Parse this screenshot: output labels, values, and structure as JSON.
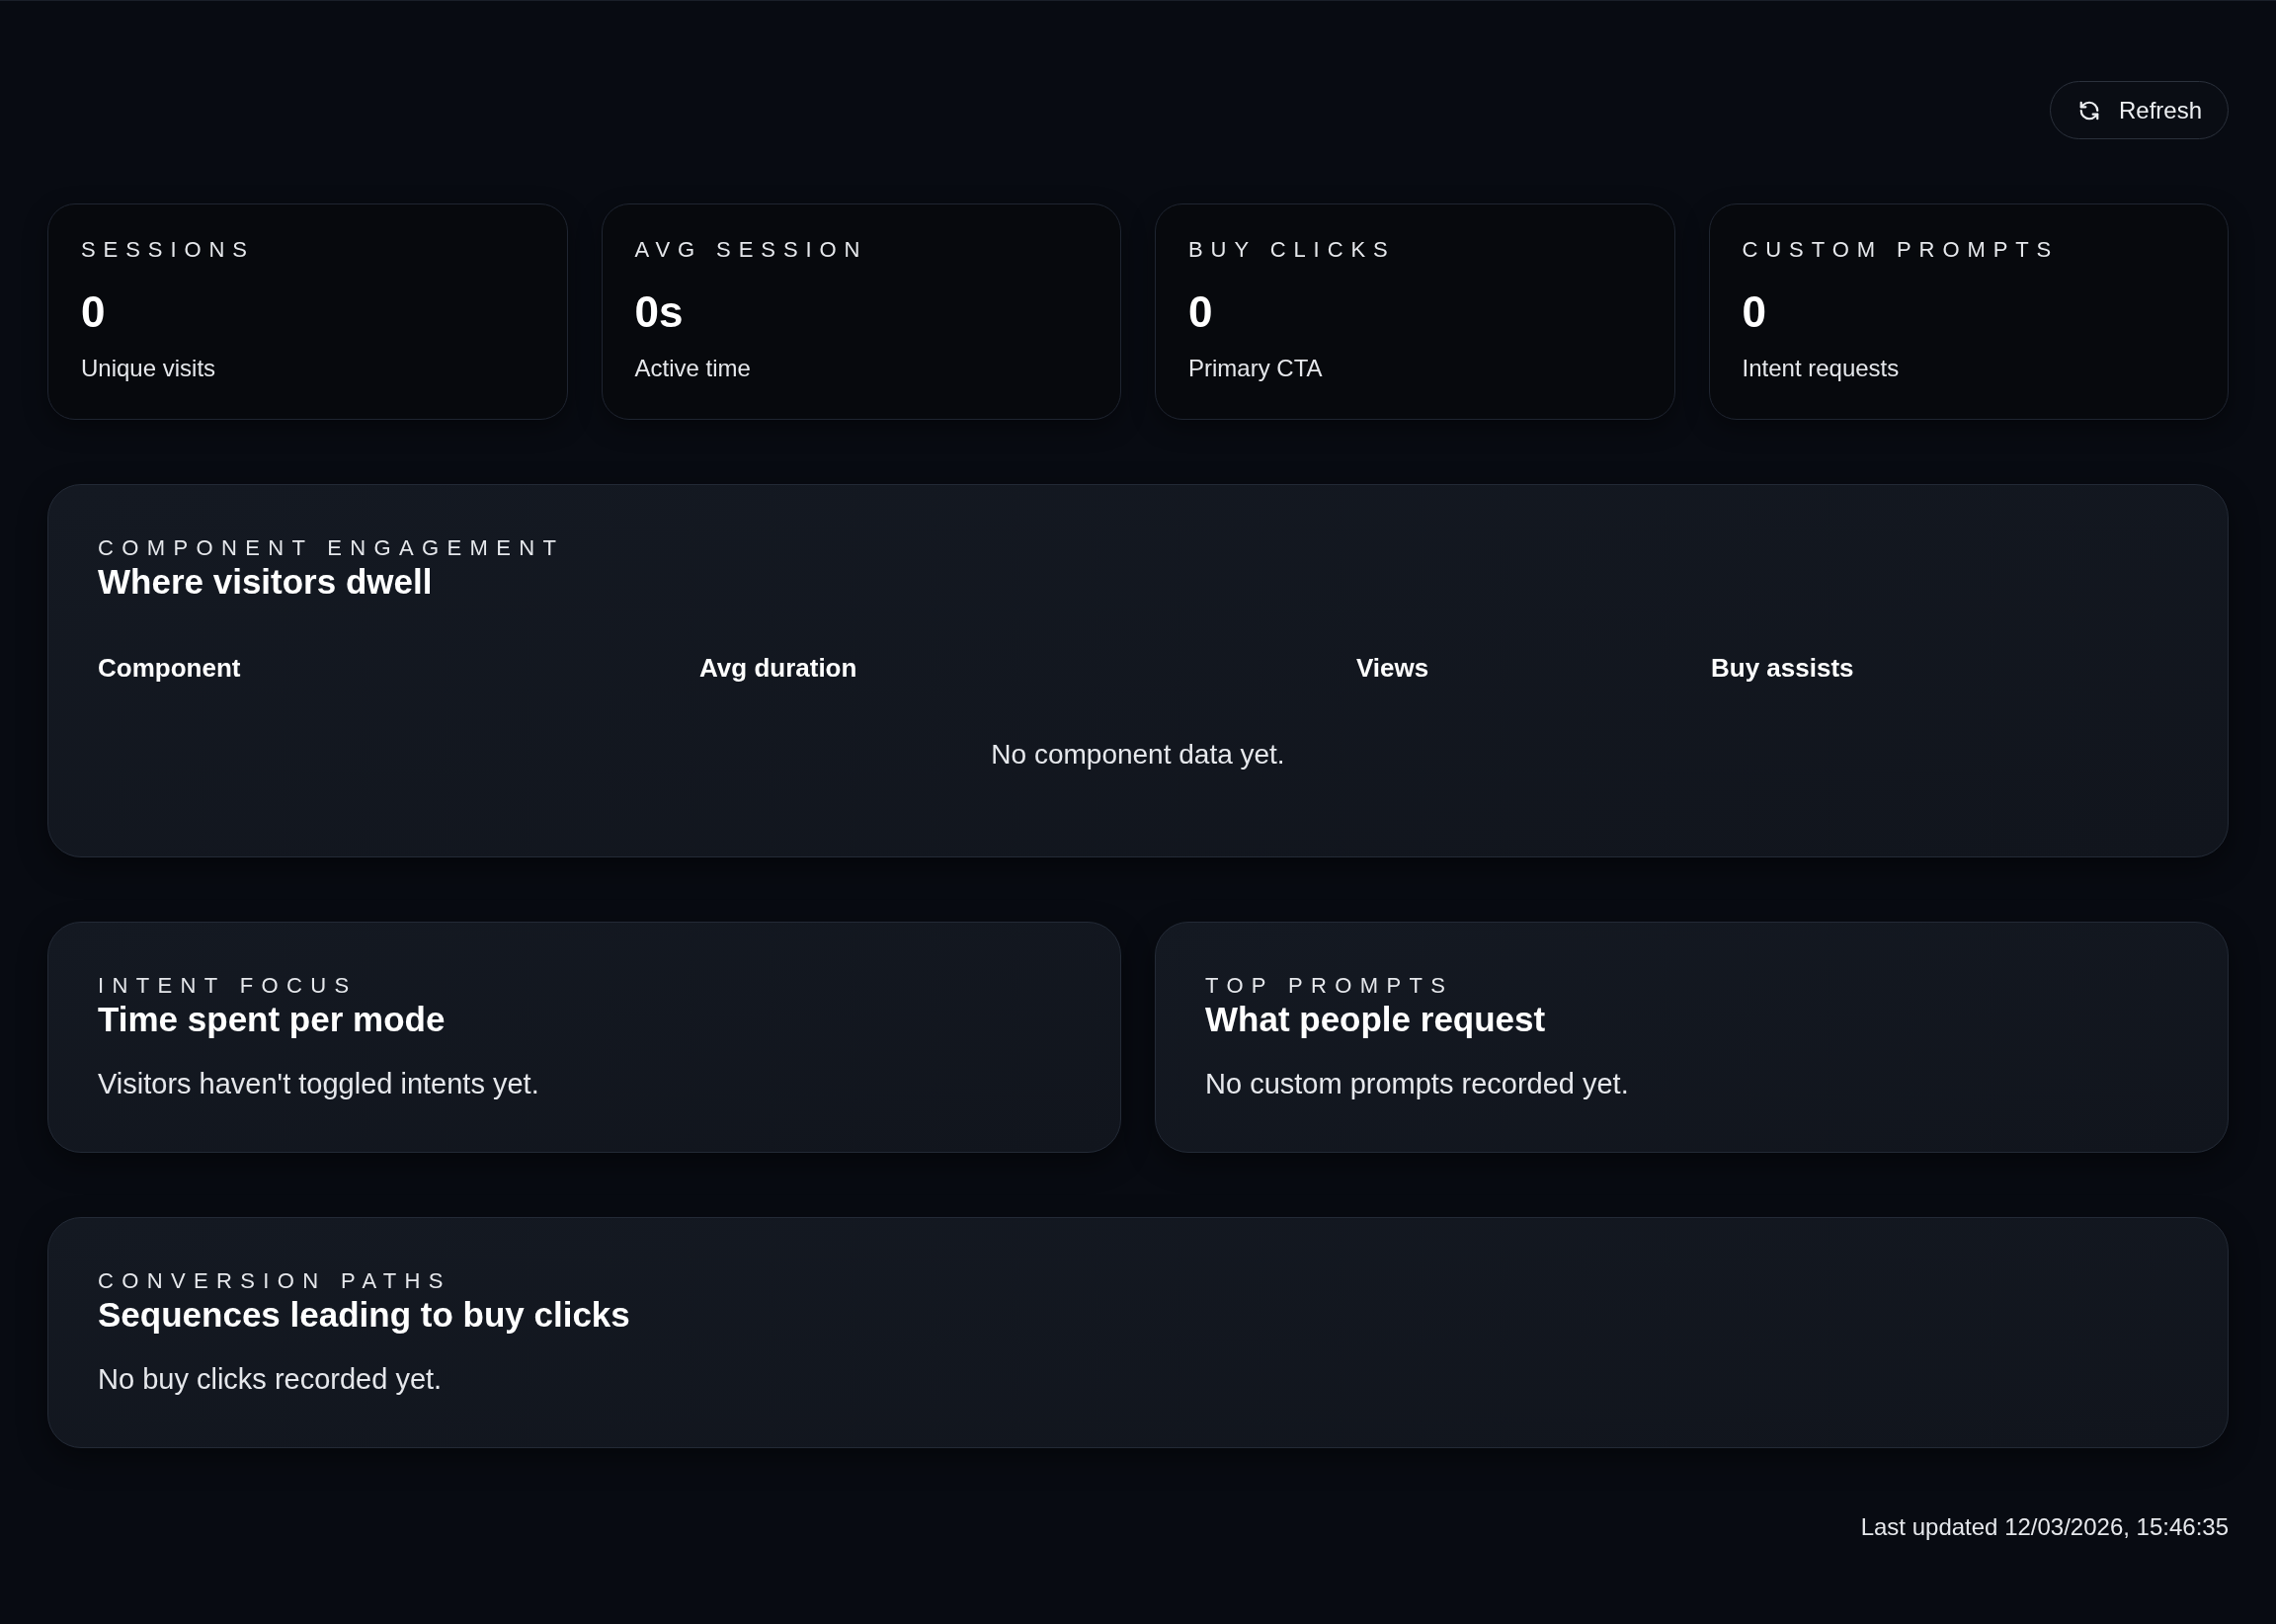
{
  "toolbar": {
    "refresh_button": {
      "label": "Refresh"
    }
  },
  "stats": [
    {
      "label": "SESSIONS",
      "value": "0",
      "caption": "Unique visits"
    },
    {
      "label": "AVG SESSION",
      "value": "0s",
      "caption": "Active time"
    },
    {
      "label": "BUY CLICKS",
      "value": "0",
      "caption": "Primary CTA"
    },
    {
      "label": "CUSTOM PROMPTS",
      "value": "0",
      "caption": "Intent requests"
    }
  ],
  "component_engagement": {
    "eyebrow": "COMPONENT ENGAGEMENT",
    "title": "Where visitors dwell",
    "table": {
      "columns": [
        "Component",
        "Avg duration",
        "Views",
        "Buy assists"
      ],
      "empty_message": "No component data yet."
    }
  },
  "panels": [
    {
      "eyebrow": "INTENT FOCUS",
      "title": "Time spent per mode",
      "message": "Visitors haven't toggled intents yet."
    },
    {
      "eyebrow": "TOP PROMPTS",
      "title": "What people request",
      "message": "No custom prompts recorded yet."
    }
  ],
  "conversion_paths": {
    "eyebrow": "CONVERSION PATHS",
    "title": "Sequences leading to buy clicks",
    "message": "No buy clicks recorded yet."
  },
  "footer": {
    "last_updated": "Last updated 12/03/2026, 15:46:35"
  }
}
